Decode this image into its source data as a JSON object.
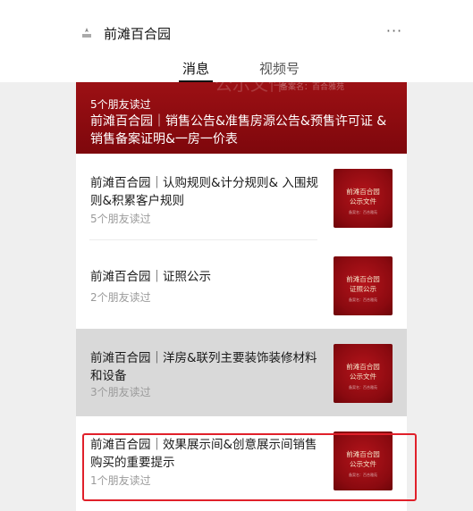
{
  "account": {
    "name": "前滩百合园",
    "more_label": "···"
  },
  "tabs": [
    {
      "label": "消息",
      "active": true
    },
    {
      "label": "视频号",
      "active": false
    }
  ],
  "hero": {
    "reads": "5个朋友读过",
    "title": "前滩百合园｜销售公告&准售房源公告&预售许可证 &销售备案证明&一房一价表",
    "background_text": "备案名：百合雅苑",
    "background_large_text": "公示文件"
  },
  "articles": [
    {
      "title": "前滩百合园｜认购规则&计分规则& 入围规则&积累客户规则",
      "reads": "5个朋友读过",
      "thumb_line1": "前滩百合园",
      "thumb_line2": "公示文件",
      "thumb_small": "备案名：百合雅苑"
    },
    {
      "title": "前滩百合园｜证照公示",
      "reads": "2个朋友读过",
      "thumb_line1": "前滩百合园",
      "thumb_line2": "证照公示",
      "thumb_small": "备案名：百合雅苑"
    },
    {
      "title": "前滩百合园｜洋房&联列主要装饰装修材料和设备",
      "reads": "3个朋友读过",
      "thumb_line1": "前滩百合园",
      "thumb_line2": "公示文件",
      "thumb_small": "备案名：百合雅苑"
    },
    {
      "title": "前滩百合园｜效果展示间&创意展示间销售购买的重要提示",
      "reads": "1个朋友读过",
      "thumb_line1": "前滩百合园",
      "thumb_line2": "公示文件",
      "thumb_small": "备案名：百合雅苑"
    }
  ],
  "colors": {
    "accent_red": "#8b0a10",
    "highlight_box": "#e0202a",
    "hover_bg": "#d9d9d9"
  }
}
